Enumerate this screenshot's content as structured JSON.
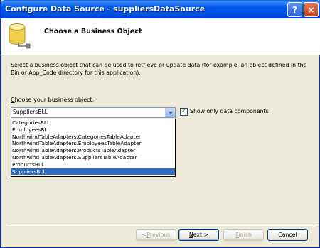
{
  "window": {
    "title": "Configure Data Source - suppliersDataSource",
    "help_glyph": "?",
    "close_glyph": "×"
  },
  "header": {
    "title": "Choose a Business Object",
    "icon": "database-icon"
  },
  "description": "Select a business object that can be used to retrieve or update data (for example, an object defined in the Bin or App_Code directory for this application).",
  "business_object": {
    "label_prefix": "",
    "label_access": "C",
    "label_rest": "hoose your business object:",
    "selected_value": "SuppliersBLL",
    "options": [
      "CategoriesBLL",
      "EmployeesBLL",
      "NorthwindTableAdapters.CategoriesTableAdapter",
      "NorthwindTableAdapters.EmployeesTableAdapter",
      "NorthwindTableAdapters.ProductsTableAdapter",
      "NorthwindTableAdapters.SuppliersTableAdapter",
      "ProductsBLL",
      "SuppliersBLL"
    ],
    "highlighted_index": 7
  },
  "show_only_data_components": {
    "checked": true,
    "label_access": "S",
    "label_rest": "how only data components"
  },
  "buttons": {
    "previous_prefix": "< ",
    "previous_access": "P",
    "previous_rest": "revious",
    "next_access": "N",
    "next_rest": "ext >",
    "finish_access": "F",
    "finish_rest": "inish",
    "cancel": "Cancel"
  }
}
